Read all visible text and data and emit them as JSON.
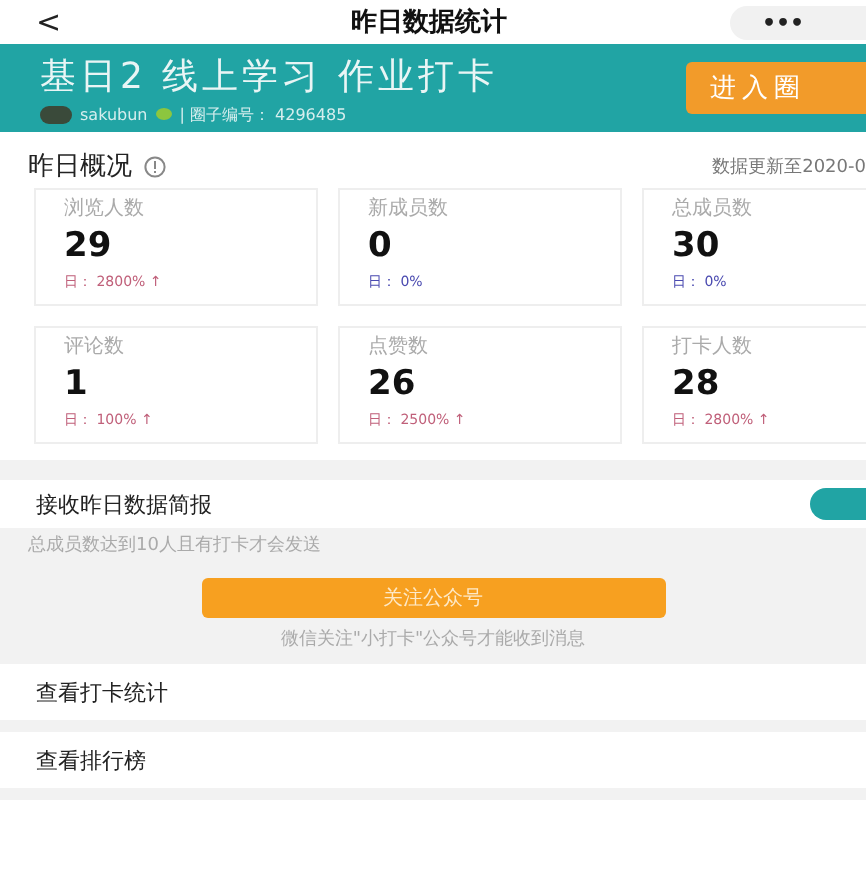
{
  "nav": {
    "back": "<",
    "title": "昨日数据统计",
    "more": "•••"
  },
  "group": {
    "name": "基日2 线上学习 作业打卡",
    "owner": "sakubun",
    "id_text": "| 圈子编号： 4296485",
    "enter": "进入圈"
  },
  "overview": {
    "title": "昨日概况",
    "updated": "数据更新至2020-0",
    "stats": [
      {
        "label": "浏览人数",
        "value": "29",
        "change": "日： 2800% ↑",
        "color": "#c0607a"
      },
      {
        "label": "新成员数",
        "value": "0",
        "change": "日： 0%",
        "color": "#4a4ab0"
      },
      {
        "label": "总成员数",
        "value": "30",
        "change": "日： 0%",
        "color": "#4a4ab0"
      },
      {
        "label": "评论数",
        "value": "1",
        "change": "日： 100% ↑",
        "color": "#c0607a"
      },
      {
        "label": "点赞数",
        "value": "26",
        "change": "日： 2500% ↑",
        "color": "#c0607a"
      },
      {
        "label": "打卡人数",
        "value": "28",
        "change": "日： 2800% ↑",
        "color": "#c0607a"
      }
    ]
  },
  "report": {
    "label": "接收昨日数据简报",
    "on": true,
    "hint": "总成员数达到10人且有打卡才会发送",
    "follow": "关注公众号",
    "note": "微信关注\"小打卡\"公众号才能收到消息"
  },
  "links": [
    "查看打卡统计",
    "查看排行榜"
  ]
}
